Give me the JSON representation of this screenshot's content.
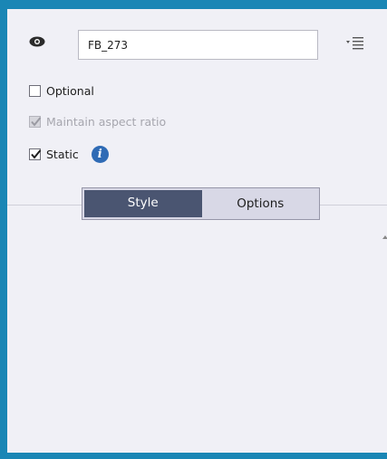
{
  "name_field": {
    "value": "FB_273"
  },
  "visibility_icon": "eye-icon",
  "menu_icon": "panel-menu-icon",
  "checkboxes": [
    {
      "label": "Optional",
      "checked": false,
      "enabled": true
    },
    {
      "label": "Maintain aspect ratio",
      "checked": true,
      "enabled": false
    },
    {
      "label": "Static",
      "checked": true,
      "enabled": true
    }
  ],
  "info_icon": {
    "glyph": "i"
  },
  "tabs": [
    {
      "label": "Style",
      "active": true
    },
    {
      "label": "Options",
      "active": false
    }
  ],
  "colors": {
    "frame": "#1a86b5",
    "panel_bg": "#f0f0f6",
    "active_tab": "#4a5571",
    "inactive_tab": "#d8d8e6",
    "info": "#2f6bb5"
  }
}
